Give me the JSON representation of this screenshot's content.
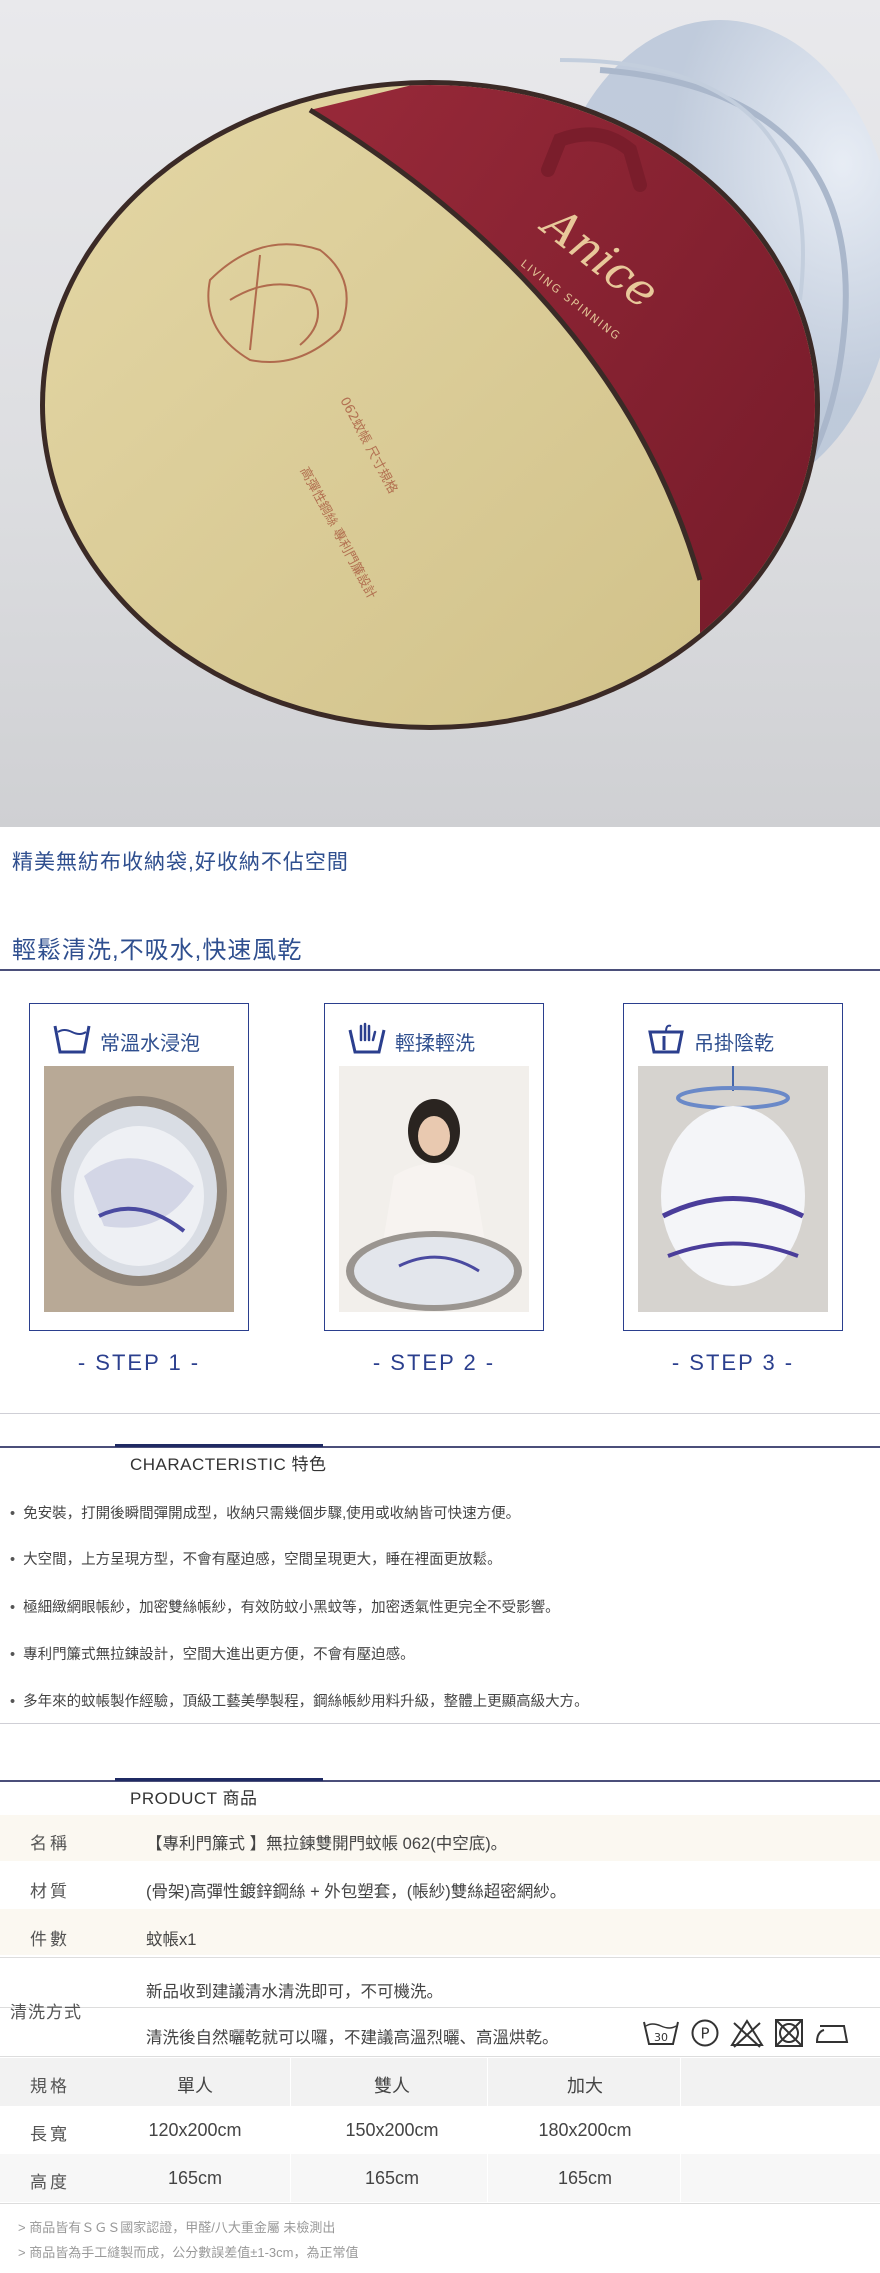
{
  "hero": {
    "bag_brand_script": "Anice",
    "bag_brand_sub": "LIVING SPINNING"
  },
  "captions": {
    "storage": "精美無紡布收納袋,好收納不佔空間",
    "washing": "輕鬆清洗,不吸水,快速風乾"
  },
  "steps": [
    {
      "title": "常溫水浸泡",
      "label": "- STEP 1 -"
    },
    {
      "title": "輕揉輕洗",
      "label": "- STEP 2 -"
    },
    {
      "title": "吊掛陰乾",
      "label": "- STEP 3 -"
    }
  ],
  "characteristic": {
    "heading": "CHARACTERISTIC 特色",
    "items": [
      "免安裝，打開後瞬間彈開成型，收納只需幾個步驟,使用或收納皆可快速方便。",
      "大空間，上方呈現方型，不會有壓迫感，空間呈現更大，睡在裡面更放鬆。",
      "極細緻網眼帳紗，加密雙絲帳紗，有效防蚊小黑蚊等，加密透氣性更完全不受影響。",
      "專利門簾式無拉鍊設計，空間大進出更方便，不會有壓迫感。",
      "多年來的蚊帳製作經驗，頂級工藝美學製程，鋼絲帳紗用料升級，整體上更顯高級大方。"
    ]
  },
  "product": {
    "heading": "PRODUCT 商品",
    "name_label": "名稱",
    "name_value": "【專利門簾式 】無拉鍊雙開門蚊帳 062(中空底)。",
    "material_label": "材質",
    "material_value": "(骨架)高彈性鍍鋅鋼絲 + 外包塑套，(帳紗)雙絲超密網紗。",
    "count_label": "件數",
    "count_value": "蚊帳x1",
    "wash_label": "清洗方式",
    "wash_value_1": "新品收到建議清水清洗即可，不可機洗。",
    "wash_value_2": "清洗後自然曬乾就可以囉，不建議高溫烈曬、高溫烘乾。",
    "care_icons": [
      "wash-30-icon",
      "professional-clean-p-icon",
      "no-bleach-icon",
      "no-tumble-dry-icon",
      "iron-low-icon"
    ],
    "care_wash_temp": "30",
    "care_p": "P"
  },
  "spec": {
    "label": "規格",
    "headers": [
      "單人",
      "雙人",
      "加大"
    ],
    "rows": [
      {
        "label": "長寬",
        "values": [
          "120x200cm",
          "150x200cm",
          "180x200cm"
        ]
      },
      {
        "label": "高度",
        "values": [
          "165cm",
          "165cm",
          "165cm"
        ]
      }
    ]
  },
  "notes": [
    "> 商品皆有ＳＧＳ國家認證，甲醛/八大重金屬 未檢測出",
    "> 商品皆為手工縫製而成，公分數誤差值±1-3cm，為正常值"
  ]
}
